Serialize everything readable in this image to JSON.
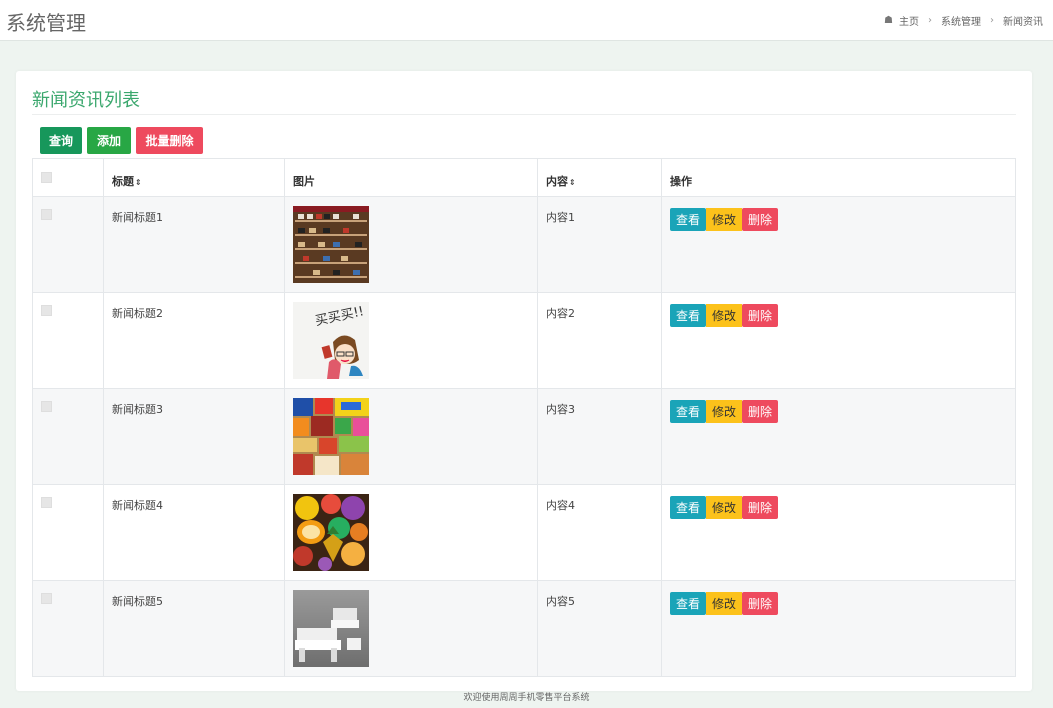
{
  "header": {
    "title": "系统管理",
    "breadcrumb": [
      "主页",
      "系统管理",
      "新闻资讯"
    ]
  },
  "card": {
    "title": "新闻资讯列表"
  },
  "toolbar": {
    "query_label": "查询",
    "add_label": "添加",
    "batch_delete_label": "批量删除"
  },
  "table": {
    "columns": [
      "标题",
      "图片",
      "内容",
      "操作"
    ],
    "sort_icon": "⇕",
    "actions": {
      "view": "查看",
      "edit": "修改",
      "delete": "删除"
    },
    "rows": [
      {
        "title": "新闻标题1",
        "content": "内容1",
        "image": "shoe-shelf"
      },
      {
        "title": "新闻标题2",
        "content": "内容2",
        "image": "cartoon-girl-buy"
      },
      {
        "title": "新闻标题3",
        "content": "内容3",
        "image": "snacks"
      },
      {
        "title": "新闻标题4",
        "content": "内容4",
        "image": "fruits"
      },
      {
        "title": "新闻标题5",
        "content": "内容5",
        "image": "white-sofas"
      }
    ]
  },
  "image_text": {
    "buy": "买买买!!"
  },
  "footer": {
    "text": "欢迎使用周周手机零售平台系统"
  },
  "colors": {
    "accent": "#3aa76d",
    "query": "#17975b",
    "add": "#28a745",
    "danger": "#ee4a5e",
    "view": "#1aa4b8",
    "edit": "#fcc21b"
  }
}
